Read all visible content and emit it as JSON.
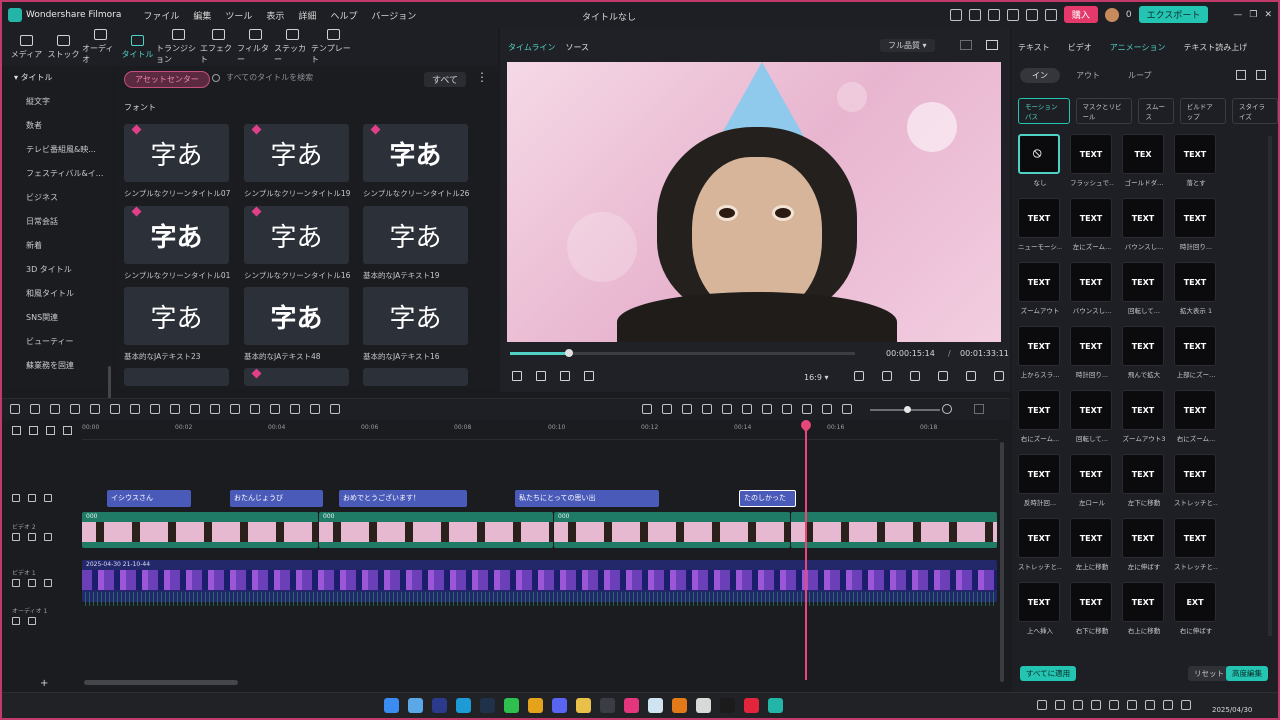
{
  "app": {
    "name": "Wondershare Filmora",
    "doc_title": "タイトルなし"
  },
  "menu": [
    "ファイル",
    "編集",
    "ツール",
    "表示",
    "詳細",
    "ヘルプ",
    "バージョン"
  ],
  "titlebar": {
    "buy": "購入",
    "points": "0",
    "export": "エクスポート"
  },
  "toolbar": [
    {
      "label": "メディア",
      "icon": "media-icon"
    },
    {
      "label": "ストック",
      "icon": "stock-icon"
    },
    {
      "label": "オーディオ",
      "icon": "audio-icon"
    },
    {
      "label": "タイトル",
      "icon": "title-icon",
      "active": true
    },
    {
      "label": "トランジション",
      "icon": "transition-icon"
    },
    {
      "label": "エフェクト",
      "icon": "effect-icon"
    },
    {
      "label": "フィルター",
      "icon": "filter-icon"
    },
    {
      "label": "ステッカー",
      "icon": "sticker-icon"
    },
    {
      "label": "テンプレート",
      "icon": "template-icon"
    }
  ],
  "sidebar": {
    "head": "タイトル",
    "items": [
      "縦文字",
      "数者",
      "テレビ番組風&映...",
      "フェスティバル&イ...",
      "ビジネス",
      "日常会話",
      "新着",
      "3D タイトル",
      "和風タイトル",
      "SNS関連",
      "ビューティー",
      "蘇業務を固連"
    ]
  },
  "library": {
    "asset_center": "アセットセンター",
    "search_placeholder": "すべてのタイトルを検索",
    "filter": "すべて",
    "section": "フォント",
    "tiles": [
      {
        "glyph": "字あ",
        "label": "シンプルなクリーンタイトル07"
      },
      {
        "glyph": "字あ",
        "label": "シンプルなクリーンタイトル19"
      },
      {
        "glyph": "字あ",
        "label": "シンプルなクリーンタイトル26"
      },
      {
        "glyph": "字あ",
        "label": "シンプルなクリーンタイトル01"
      },
      {
        "glyph": "字あ",
        "label": "シンプルなクリーンタイトル16"
      },
      {
        "glyph": "字あ",
        "label": "基本的なJAテキスト19"
      },
      {
        "glyph": "字あ",
        "label": "基本的なJAテキスト23"
      },
      {
        "glyph": "字あ",
        "label": "基本的なJAテキスト48"
      },
      {
        "glyph": "字あ",
        "label": "基本的なJAテキスト16"
      }
    ]
  },
  "preview": {
    "tabs": [
      "タイムライン",
      "ソース"
    ],
    "quality": "フル品質",
    "current_time": "00:00:15:14",
    "separator": "/",
    "total_time": "00:01:33:11",
    "ratio": "16:9",
    "progress": 0.17
  },
  "right_panel": {
    "tabs": [
      "テキスト",
      "ビデオ",
      "アニメーション",
      "テキスト読み上げ"
    ],
    "subtabs": [
      "イン",
      "アウト",
      "ループ"
    ],
    "filters": [
      "モーションパス",
      "マスクとリビール",
      "スムース",
      "ビルドアップ",
      "スタイライズ"
    ],
    "presets": [
      {
        "label": "なし",
        "text": "⃠"
      },
      {
        "label": "フラッシュで...",
        "text": "TEXT"
      },
      {
        "label": "ゴールドダ...",
        "text": "TEX"
      },
      {
        "label": "落とす",
        "text": "TEXT"
      },
      {
        "label": "ニューモーシ...",
        "text": "TEXT"
      },
      {
        "label": "左にズーム...",
        "text": "TEXT"
      },
      {
        "label": "バウンスし...",
        "text": "TEXT"
      },
      {
        "label": "時計回り...",
        "text": "TEXT"
      },
      {
        "label": "ズームアウト",
        "text": "TEXT"
      },
      {
        "label": "バウンスし...",
        "text": "TEXT"
      },
      {
        "label": "回転して...",
        "text": "TEXT"
      },
      {
        "label": "拡大表示 1",
        "text": "TEXT"
      },
      {
        "label": "上からスラ...",
        "text": "TEXT"
      },
      {
        "label": "時計回り...",
        "text": "TEXT"
      },
      {
        "label": "飛んで拡大",
        "text": "TEXT"
      },
      {
        "label": "上部にズー...",
        "text": "TEXT"
      },
      {
        "label": "右にズーム...",
        "text": "TEXT"
      },
      {
        "label": "回転して...",
        "text": "TEXT"
      },
      {
        "label": "ズームアウト3",
        "text": "TEXT"
      },
      {
        "label": "右にズーム...",
        "text": "TEXT"
      },
      {
        "label": "反時計回...",
        "text": "TEXT"
      },
      {
        "label": "左ロール",
        "text": "TEXT"
      },
      {
        "label": "左下に移動",
        "text": "TEXT"
      },
      {
        "label": "ストレッチと...",
        "text": "TEXT"
      },
      {
        "label": "ストレッチと...",
        "text": "TEXT"
      },
      {
        "label": "左上に移動",
        "text": "TEXT"
      },
      {
        "label": "左に伸ばす",
        "text": "TEXT"
      },
      {
        "label": "ストレッチと...",
        "text": "TEXT"
      },
      {
        "label": "上へ挿入",
        "text": "TEXT"
      },
      {
        "label": "右下に移動",
        "text": "TEXT"
      },
      {
        "label": "右上に移動",
        "text": "TEXT"
      },
      {
        "label": "右に伸ばす",
        "text": "EXT"
      }
    ],
    "apply_all": "すべてに適用",
    "reset": "リセット",
    "advanced": "高度編集"
  },
  "timeline": {
    "ruler": [
      "00:00",
      "00:02",
      "00:04",
      "00:06",
      "00:08",
      "00:10",
      "00:12",
      "00:14",
      "00:16",
      "00:18"
    ],
    "tracks": {
      "video2": "ビデオ 2",
      "video1": "ビデオ 1",
      "audio1": "オーディオ 1"
    },
    "title_clips": [
      "イシウスさん",
      "おたんじょうび",
      "おめでとうございます！",
      "私たちにとっての思い出",
      "たのしかった"
    ],
    "video_clip_label": "000",
    "video1_label": "2025-04-30 21-10-44"
  },
  "taskbar": {
    "date": "2025/04/30"
  }
}
